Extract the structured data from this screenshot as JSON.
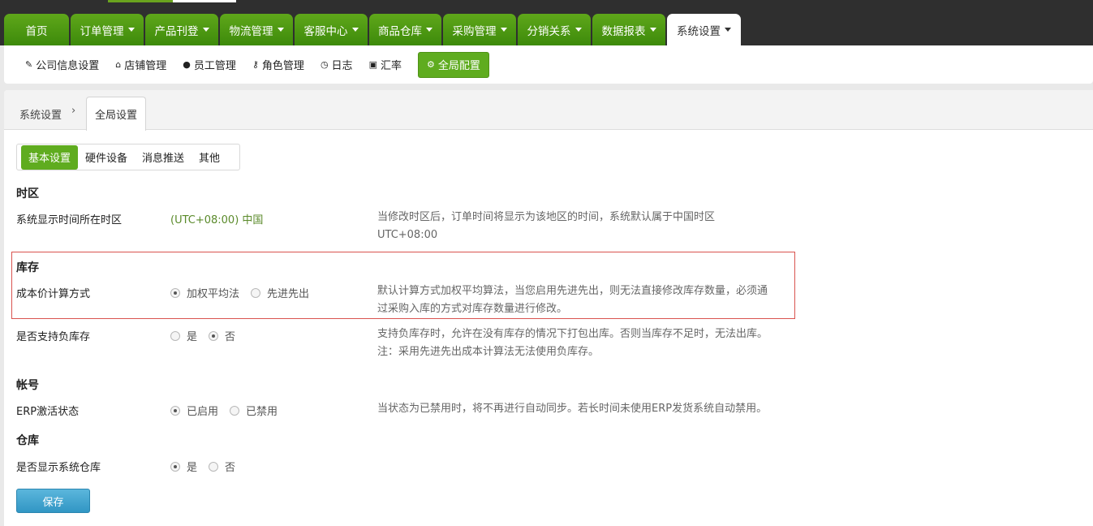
{
  "main_nav": [
    {
      "label": "首页",
      "caret": false,
      "active": false
    },
    {
      "label": "订单管理",
      "caret": true,
      "active": false
    },
    {
      "label": "产品刊登",
      "caret": true,
      "active": false
    },
    {
      "label": "物流管理",
      "caret": true,
      "active": false
    },
    {
      "label": "客服中心",
      "caret": true,
      "active": false
    },
    {
      "label": "商品仓库",
      "caret": true,
      "active": false
    },
    {
      "label": "采购管理",
      "caret": true,
      "active": false
    },
    {
      "label": "分销关系",
      "caret": true,
      "active": false
    },
    {
      "label": "数据报表",
      "caret": true,
      "active": false
    },
    {
      "label": "系统设置",
      "caret": true,
      "active": true
    }
  ],
  "sub_nav": [
    {
      "icon": "edit-icon",
      "glyph": "✎",
      "label": "公司信息设置",
      "active": false
    },
    {
      "icon": "home-icon",
      "glyph": "⌂",
      "label": "店铺管理",
      "active": false
    },
    {
      "icon": "user-icon",
      "glyph": "●",
      "label": "员工管理",
      "active": false
    },
    {
      "icon": "key-icon",
      "glyph": "⚷",
      "label": "角色管理",
      "active": false
    },
    {
      "icon": "clock-icon",
      "glyph": "◷",
      "label": "日志",
      "active": false
    },
    {
      "icon": "money-icon",
      "glyph": "▣",
      "label": "汇率",
      "active": false
    },
    {
      "icon": "gear-icon",
      "glyph": "⚙",
      "label": "全局配置",
      "active": true
    }
  ],
  "breadcrumb": {
    "parent": "系统设置",
    "separator": "›",
    "current": "全局设置"
  },
  "settings_tabs": [
    {
      "label": "基本设置",
      "active": true
    },
    {
      "label": "硬件设备",
      "active": false
    },
    {
      "label": "消息推送",
      "active": false
    },
    {
      "label": "其他",
      "active": false
    }
  ],
  "timezone": {
    "section_title": "时区",
    "label": "系统显示时间所在时区",
    "value": "(UTC+08:00) 中国",
    "desc_line1": "当修改时区后，订单时间将显示为该地区的时间，系统默认属于中国时区",
    "desc_line2": "UTC+08:00"
  },
  "inventory": {
    "section_title": "库存",
    "cost": {
      "label": "成本价计算方式",
      "options": [
        {
          "label": "加权平均法",
          "checked": true
        },
        {
          "label": "先进先出",
          "checked": false
        }
      ],
      "desc_line1": "默认计算方式加权平均算法，当您启用先进先出，则无法直接修改库存数量，必须通",
      "desc_line2": "过采购入库的方式对库存数量进行修改。"
    },
    "negative": {
      "label": "是否支持负库存",
      "options": [
        {
          "label": "是",
          "checked": false
        },
        {
          "label": "否",
          "checked": true
        }
      ],
      "desc_line1": "支持负库存时，允许在没有库存的情况下打包出库。否则当库存不足时，无法出库。",
      "desc_line2": "注：采用先进先出成本计算法无法使用负库存。"
    }
  },
  "account": {
    "section_title": "帐号",
    "label": "ERP激活状态",
    "options": [
      {
        "label": "已启用",
        "checked": true
      },
      {
        "label": "已禁用",
        "checked": false
      }
    ],
    "desc": "当状态为已禁用时，将不再进行自动同步。若长时间未使用ERP发货系统自动禁用。"
  },
  "warehouse": {
    "section_title": "仓库",
    "label": "是否显示系统仓库",
    "options": [
      {
        "label": "是",
        "checked": true
      },
      {
        "label": "否",
        "checked": false
      }
    ]
  },
  "save_label": "保存",
  "colors": {
    "accent_green": "#5fac1f",
    "header_dark": "#2f2f2f",
    "save_blue": "#3196c4",
    "highlight_red": "#d9534f"
  }
}
